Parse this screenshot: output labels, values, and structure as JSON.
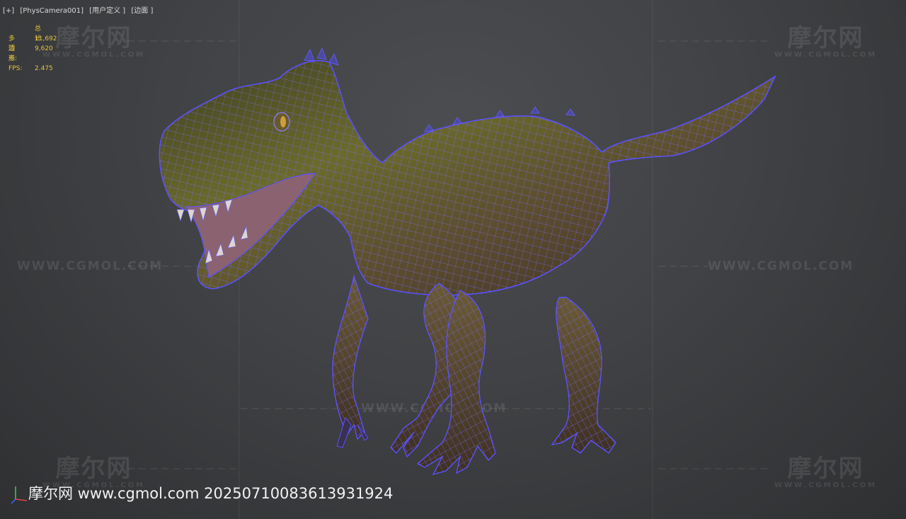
{
  "viewport": {
    "label_parts": [
      "[+]",
      "[PhysCamera001]",
      "[用户定义 ]",
      "[边面 ]"
    ]
  },
  "stats": {
    "header": "总计",
    "rows": [
      {
        "label": "多边形:",
        "value": "11,692"
      },
      {
        "label": "顶点:",
        "value": "9,620"
      }
    ],
    "fps_label": "FPS:",
    "fps_value": "2.475"
  },
  "watermarks": {
    "logo_cn": "摩尔网",
    "logo_en": "WWW.CGMOL.COM",
    "url": "WWW.CGMOL.COM",
    "bottom_text": "摩尔网 www.cgmol.com 20250710083613931924"
  },
  "colors": {
    "stats_text": "#e8c33a",
    "wireframe": "#6f64ff",
    "viewport_bg": "#404245"
  },
  "icons": [
    "axis-gizmo-icon"
  ]
}
